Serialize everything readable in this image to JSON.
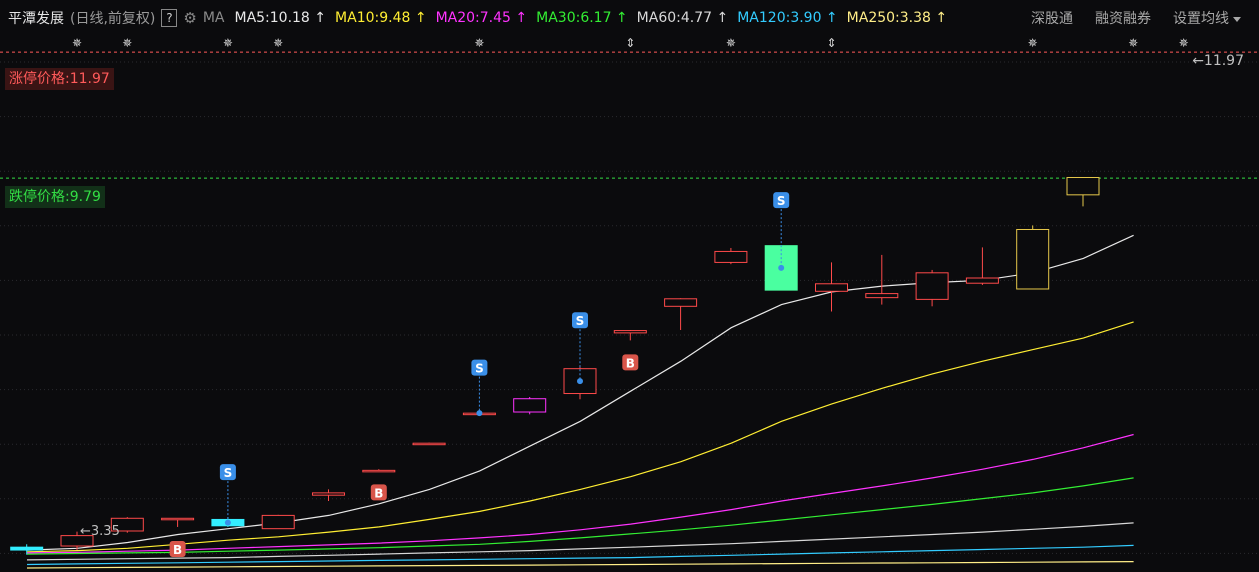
{
  "header": {
    "stock_name": "平潭发展",
    "mode": "(日线,前复权)",
    "help": "?",
    "ma_label": "MA",
    "ma_values": [
      {
        "text": "MA5:10.18",
        "color": "#e8e8e8"
      },
      {
        "text": "MA10:9.48",
        "color": "#ffee33"
      },
      {
        "text": "MA20:7.45",
        "color": "#ff33ff"
      },
      {
        "text": "MA30:6.17",
        "color": "#33ee33"
      },
      {
        "text": "MA60:4.77",
        "color": "#d8d8d8"
      },
      {
        "text": "MA120:3.90",
        "color": "#33ccff"
      },
      {
        "text": "MA250:3.38",
        "color": "#ffee88"
      }
    ],
    "arrow": "↑",
    "right_menu": [
      "深股通",
      "融资融券",
      "设置均线"
    ]
  },
  "limits": {
    "up_label": "涨停价格:11.97",
    "down_label": "跌停价格:9.79",
    "up_color": "#ff5a5a",
    "down_color": "#33dd44"
  },
  "price_tag": "←11.97",
  "low_tag": "←3.35",
  "chart_data": {
    "type": "candlestick",
    "candles": [
      {
        "open": 3.35,
        "high": 3.45,
        "low": 3.27,
        "close": 3.4,
        "color": "cyan"
      },
      {
        "open": 3.42,
        "high": 3.67,
        "low": 3.35,
        "close": 3.6,
        "color": "red"
      },
      {
        "open": 3.9,
        "high": 3.92,
        "low": 3.65,
        "close": 3.68,
        "color": "red"
      },
      {
        "open": 3.9,
        "high": 3.9,
        "low": 3.75,
        "close": 3.88,
        "color": "red"
      },
      {
        "open": 3.88,
        "high": 3.92,
        "low": 3.75,
        "close": 3.77,
        "color": "cyan"
      },
      {
        "open": 3.72,
        "high": 3.96,
        "low": 3.72,
        "close": 3.95,
        "color": "red"
      },
      {
        "open": 4.34,
        "high": 4.4,
        "low": 4.2,
        "close": 4.3,
        "color": "red"
      },
      {
        "open": 4.73,
        "high": 4.75,
        "low": 4.73,
        "close": 4.73,
        "color": "red"
      },
      {
        "open": 5.2,
        "high": 5.21,
        "low": 5.2,
        "close": 5.2,
        "color": "red"
      },
      {
        "open": 5.72,
        "high": 5.73,
        "low": 5.72,
        "close": 5.72,
        "color": "red"
      },
      {
        "open": 5.74,
        "high": 6.0,
        "low": 5.7,
        "close": 5.97,
        "color": "magenta"
      },
      {
        "open": 6.06,
        "high": 6.55,
        "low": 5.96,
        "close": 6.49,
        "color": "red"
      },
      {
        "open": 7.11,
        "high": 7.16,
        "low": 6.98,
        "close": 7.15,
        "color": "red"
      },
      {
        "open": 7.57,
        "high": 7.71,
        "low": 7.16,
        "close": 7.7,
        "color": "red"
      },
      {
        "open": 8.52,
        "high": 8.58,
        "low": 8.3,
        "close": 8.33,
        "color": "red"
      },
      {
        "open": 8.62,
        "high": 8.63,
        "low": 7.85,
        "close": 7.85,
        "color": "green"
      },
      {
        "open": 7.83,
        "high": 8.33,
        "low": 7.48,
        "close": 7.96,
        "color": "red"
      },
      {
        "open": 7.72,
        "high": 8.46,
        "low": 7.6,
        "close": 7.79,
        "color": "red"
      },
      {
        "open": 7.69,
        "high": 8.2,
        "low": 7.57,
        "close": 8.15,
        "color": "red"
      },
      {
        "open": 7.97,
        "high": 8.59,
        "low": 7.94,
        "close": 8.06,
        "color": "red"
      },
      {
        "open": 7.87,
        "high": 8.97,
        "low": 7.87,
        "close": 8.9,
        "color": "yellow"
      },
      {
        "open": 9.5,
        "high": 9.8,
        "low": 9.3,
        "close": 9.8,
        "color": "yellow"
      }
    ],
    "ma_lines": [
      {
        "name": "MA5",
        "color": "#e8e8e8",
        "values": [
          3.35,
          3.38,
          3.48,
          3.62,
          3.72,
          3.82,
          3.95,
          4.15,
          4.4,
          4.72,
          5.15,
          5.58,
          6.1,
          6.62,
          7.2,
          7.6,
          7.82,
          7.92,
          7.98,
          8.02,
          8.15,
          8.4,
          8.8
        ]
      },
      {
        "name": "MA10",
        "color": "#ffee33",
        "values": [
          3.32,
          3.34,
          3.38,
          3.45,
          3.52,
          3.58,
          3.66,
          3.75,
          3.88,
          4.02,
          4.2,
          4.4,
          4.62,
          4.88,
          5.2,
          5.58,
          5.88,
          6.15,
          6.4,
          6.62,
          6.82,
          7.02,
          7.3
        ]
      },
      {
        "name": "MA20",
        "color": "#ff33ff",
        "values": [
          3.3,
          3.31,
          3.33,
          3.35,
          3.38,
          3.41,
          3.44,
          3.47,
          3.51,
          3.56,
          3.62,
          3.7,
          3.8,
          3.92,
          4.05,
          4.2,
          4.33,
          4.46,
          4.6,
          4.75,
          4.92,
          5.12,
          5.35
        ]
      },
      {
        "name": "MA30",
        "color": "#33ee33",
        "values": [
          3.28,
          3.29,
          3.3,
          3.31,
          3.33,
          3.35,
          3.37,
          3.39,
          3.42,
          3.45,
          3.5,
          3.56,
          3.63,
          3.7,
          3.78,
          3.87,
          3.96,
          4.05,
          4.14,
          4.24,
          4.34,
          4.46,
          4.6
        ]
      },
      {
        "name": "MA60",
        "color": "#d8d8d8",
        "values": [
          3.18,
          3.19,
          3.2,
          3.21,
          3.22,
          3.24,
          3.26,
          3.28,
          3.3,
          3.32,
          3.34,
          3.37,
          3.4,
          3.43,
          3.46,
          3.5,
          3.54,
          3.58,
          3.62,
          3.66,
          3.71,
          3.76,
          3.82
        ]
      },
      {
        "name": "MA120",
        "color": "#33ccff",
        "values": [
          3.1,
          3.11,
          3.12,
          3.13,
          3.14,
          3.15,
          3.16,
          3.17,
          3.18,
          3.19,
          3.2,
          3.21,
          3.22,
          3.24,
          3.26,
          3.28,
          3.3,
          3.32,
          3.34,
          3.36,
          3.38,
          3.4,
          3.43
        ]
      },
      {
        "name": "MA250",
        "color": "#ffee88",
        "values": [
          3.04,
          3.045,
          3.05,
          3.055,
          3.06,
          3.065,
          3.07,
          3.075,
          3.08,
          3.085,
          3.09,
          3.095,
          3.1,
          3.105,
          3.11,
          3.115,
          3.12,
          3.125,
          3.13,
          3.135,
          3.14,
          3.145,
          3.15
        ]
      }
    ],
    "sell_markers": [
      {
        "index": 4,
        "label": "S"
      },
      {
        "index": 9,
        "label": "S"
      },
      {
        "index": 11,
        "label": "S"
      },
      {
        "index": 15,
        "label": "S"
      }
    ],
    "buy_markers": [
      {
        "index": 3,
        "label": "B"
      },
      {
        "index": 7,
        "label": "B"
      },
      {
        "index": 12,
        "label": "B"
      }
    ],
    "top_symbols": [
      {
        "index": 1,
        "symbol": "✵"
      },
      {
        "index": 2,
        "symbol": "✵"
      },
      {
        "index": 4,
        "symbol": "✵"
      },
      {
        "index": 5,
        "symbol": "✵"
      },
      {
        "index": 9,
        "symbol": "✵"
      },
      {
        "index": 12,
        "symbol": "⇕"
      },
      {
        "index": 14,
        "symbol": "✵"
      },
      {
        "index": 16,
        "symbol": "⇕"
      },
      {
        "index": 20,
        "symbol": "✵"
      },
      {
        "index": 22,
        "symbol": "✵"
      },
      {
        "index": 23,
        "symbol": "✵"
      }
    ],
    "limit_up": 11.97,
    "limit_down": 9.79,
    "ylim": [
      2.97,
      12.25
    ]
  }
}
